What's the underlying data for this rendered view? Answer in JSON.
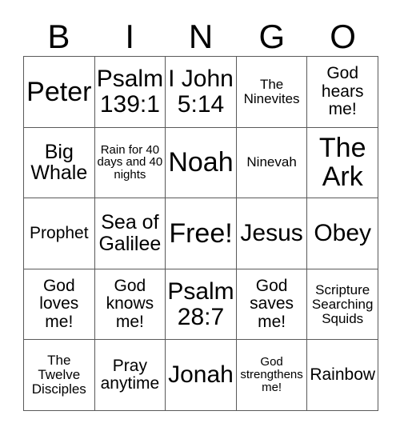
{
  "card": {
    "header_letters": [
      "B",
      "I",
      "N",
      "G",
      "O"
    ],
    "columns": 5,
    "rows": 5,
    "border_color": "#5a5a5a",
    "background_color": "#ffffff",
    "text_color": "#000000",
    "cells": [
      {
        "text": "Peter",
        "size": "fs-xl"
      },
      {
        "text": "Psalm 139:1",
        "size": "fs-lg"
      },
      {
        "text": "I John 5:14",
        "size": "fs-lg"
      },
      {
        "text": "The Ninevites",
        "size": "fs-xs"
      },
      {
        "text": "God hears me!",
        "size": "fs-sm"
      },
      {
        "text": "Big Whale",
        "size": "fs-md"
      },
      {
        "text": "Rain for 40 days and 40 nights",
        "size": "fs-xxs"
      },
      {
        "text": "Noah",
        "size": "fs-xl"
      },
      {
        "text": "Ninevah",
        "size": "fs-xs"
      },
      {
        "text": "The Ark",
        "size": "fs-xl"
      },
      {
        "text": "Prophet",
        "size": "fs-sm"
      },
      {
        "text": "Sea of Galilee",
        "size": "fs-md"
      },
      {
        "text": "Free!",
        "size": "fs-xl"
      },
      {
        "text": "Jesus",
        "size": "fs-lg"
      },
      {
        "text": "Obey",
        "size": "fs-lg"
      },
      {
        "text": "God loves me!",
        "size": "fs-sm"
      },
      {
        "text": "God knows me!",
        "size": "fs-sm"
      },
      {
        "text": "Psalm 28:7",
        "size": "fs-lg"
      },
      {
        "text": "God saves me!",
        "size": "fs-sm"
      },
      {
        "text": "Scripture Searching Squids",
        "size": "fs-xs"
      },
      {
        "text": "The Twelve Disciples",
        "size": "fs-xs"
      },
      {
        "text": "Pray anytime",
        "size": "fs-sm"
      },
      {
        "text": "Jonah",
        "size": "fs-lg"
      },
      {
        "text": "God strengthens me!",
        "size": "fs-xxs"
      },
      {
        "text": "Rainbow",
        "size": "fs-sm"
      }
    ]
  }
}
